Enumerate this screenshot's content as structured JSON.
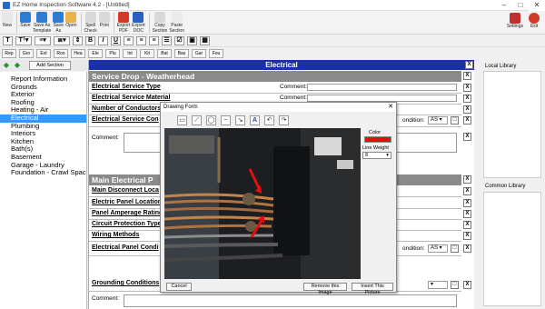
{
  "app": {
    "title": "EZ Home Inspection Software 4.2 - [Untitled]"
  },
  "toolbar": {
    "buttons": [
      {
        "label": "New",
        "color": "#e8e8e8"
      },
      {
        "label": "Save",
        "color": "#2e7bd6"
      },
      {
        "label": "Save As\nTemplate",
        "color": "#2e7bd6"
      },
      {
        "label": "Save\nAs",
        "color": "#2e7bd6"
      },
      {
        "label": "Open",
        "color": "#e8b44a"
      },
      {
        "label": "Spell\nCheck",
        "color": "#d9d9d9"
      },
      {
        "label": "Print",
        "color": "#d9d9d9"
      },
      {
        "label": "Export\nPDF",
        "color": "#d23a2a"
      },
      {
        "label": "Export\nDOC",
        "color": "#2a5fc8"
      },
      {
        "label": "Copy\nSection",
        "color": "#d9d9d9"
      },
      {
        "label": "Paste\nSection",
        "color": "#eaeaea"
      }
    ],
    "settings_label": "Settings",
    "exit_label": "Exit"
  },
  "format": {
    "bold": "B",
    "italic": "I",
    "underline": "U"
  },
  "tabs": [
    "Rep",
    "Gro",
    "Ext",
    "Roo",
    "Hea",
    "Ele",
    "Plu",
    "Int",
    "Kit",
    "Bat",
    "Bas",
    "Gar",
    "Fou"
  ],
  "left": {
    "add_section": "Add Section",
    "items": [
      "Report Information",
      "Grounds",
      "Exterior",
      "Roofing",
      "Heating - Air",
      "Electrical",
      "Plumbing",
      "Interiors",
      "Kitchen",
      "Bath(s)",
      "Basement",
      "Garage - Laundry",
      "Foundation - Crawl Spac"
    ],
    "selected_index": 5
  },
  "main": {
    "title": "Electrical",
    "section1": {
      "title": "Service Drop - Weatherhead",
      "rows": [
        "Electrical Service Type",
        "Electrical Service Material",
        "Number of Conductors",
        "Electrical Service Con"
      ],
      "comment_label": "Comment:",
      "condition_label": "ondition:",
      "condition_value": "AS"
    },
    "section2": {
      "title": "Main Electrical P",
      "rows": [
        "Main Disconnect Loca",
        "Electric Panel Location",
        "Panel Amperage Rating",
        "Circuit Protection Type",
        "Wiring Methods",
        "Electrical Panel Condi"
      ],
      "condition_label": "ondition:",
      "condition_value": "AS",
      "grounding": "Grounding Conditions",
      "comment_label": "Comment:"
    }
  },
  "right": {
    "local_library": "Local Library",
    "common_library": "Common Library"
  },
  "dialog": {
    "title": "Drawing Form",
    "color_label": "Color",
    "color_value": "#e01010",
    "line_weight_label": "Line Weight",
    "line_weight_value": "8",
    "cancel": "Cancel",
    "remove": "Remove this Image",
    "insert": "Insert This Picture"
  }
}
